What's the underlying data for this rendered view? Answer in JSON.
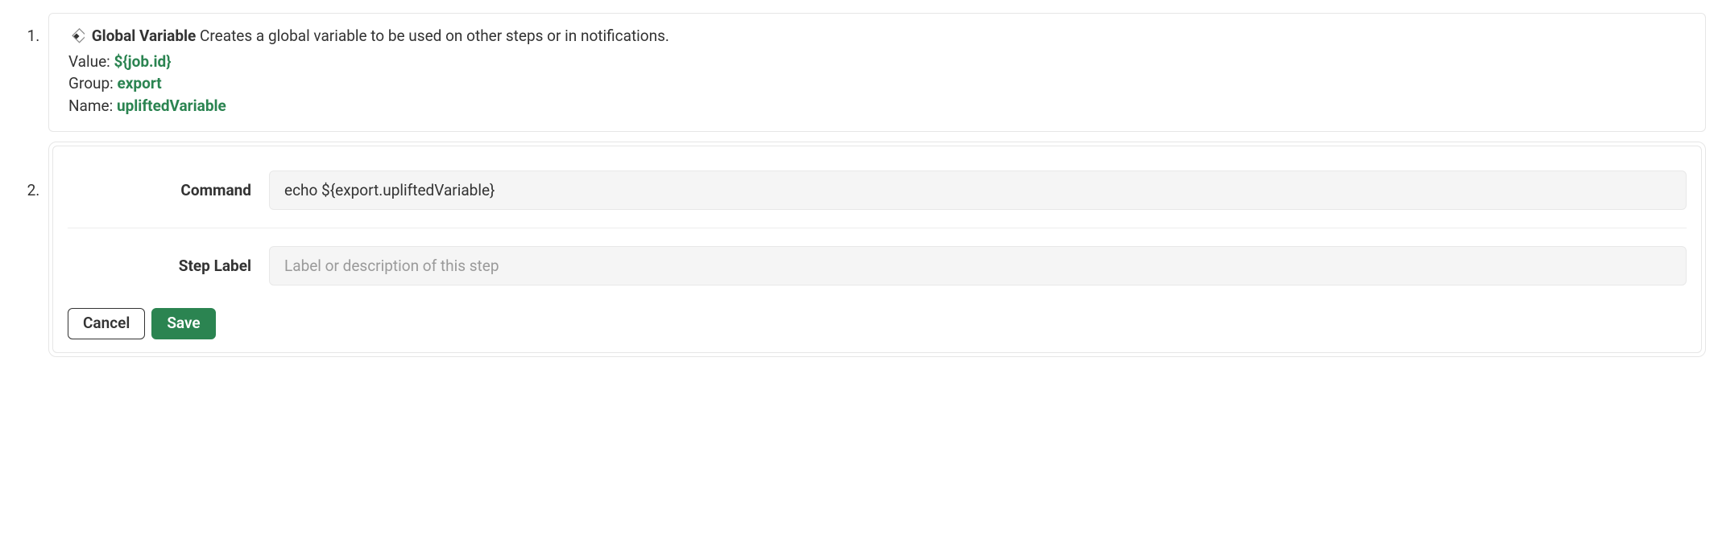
{
  "steps": {
    "step1": {
      "title_label": "Global Variable",
      "title_desc": "Creates a global variable to be used on other steps or in notifications.",
      "value_label": "Value:",
      "value": "${job.id}",
      "group_label": "Group:",
      "group": "export",
      "name_label": "Name:",
      "name": "upliftedVariable"
    },
    "step2": {
      "command_label": "Command",
      "command_value": "echo ${export.upliftedVariable}",
      "steplabel_label": "Step Label",
      "steplabel_placeholder": "Label or description of this step",
      "steplabel_value": "",
      "cancel_label": "Cancel",
      "save_label": "Save"
    }
  }
}
